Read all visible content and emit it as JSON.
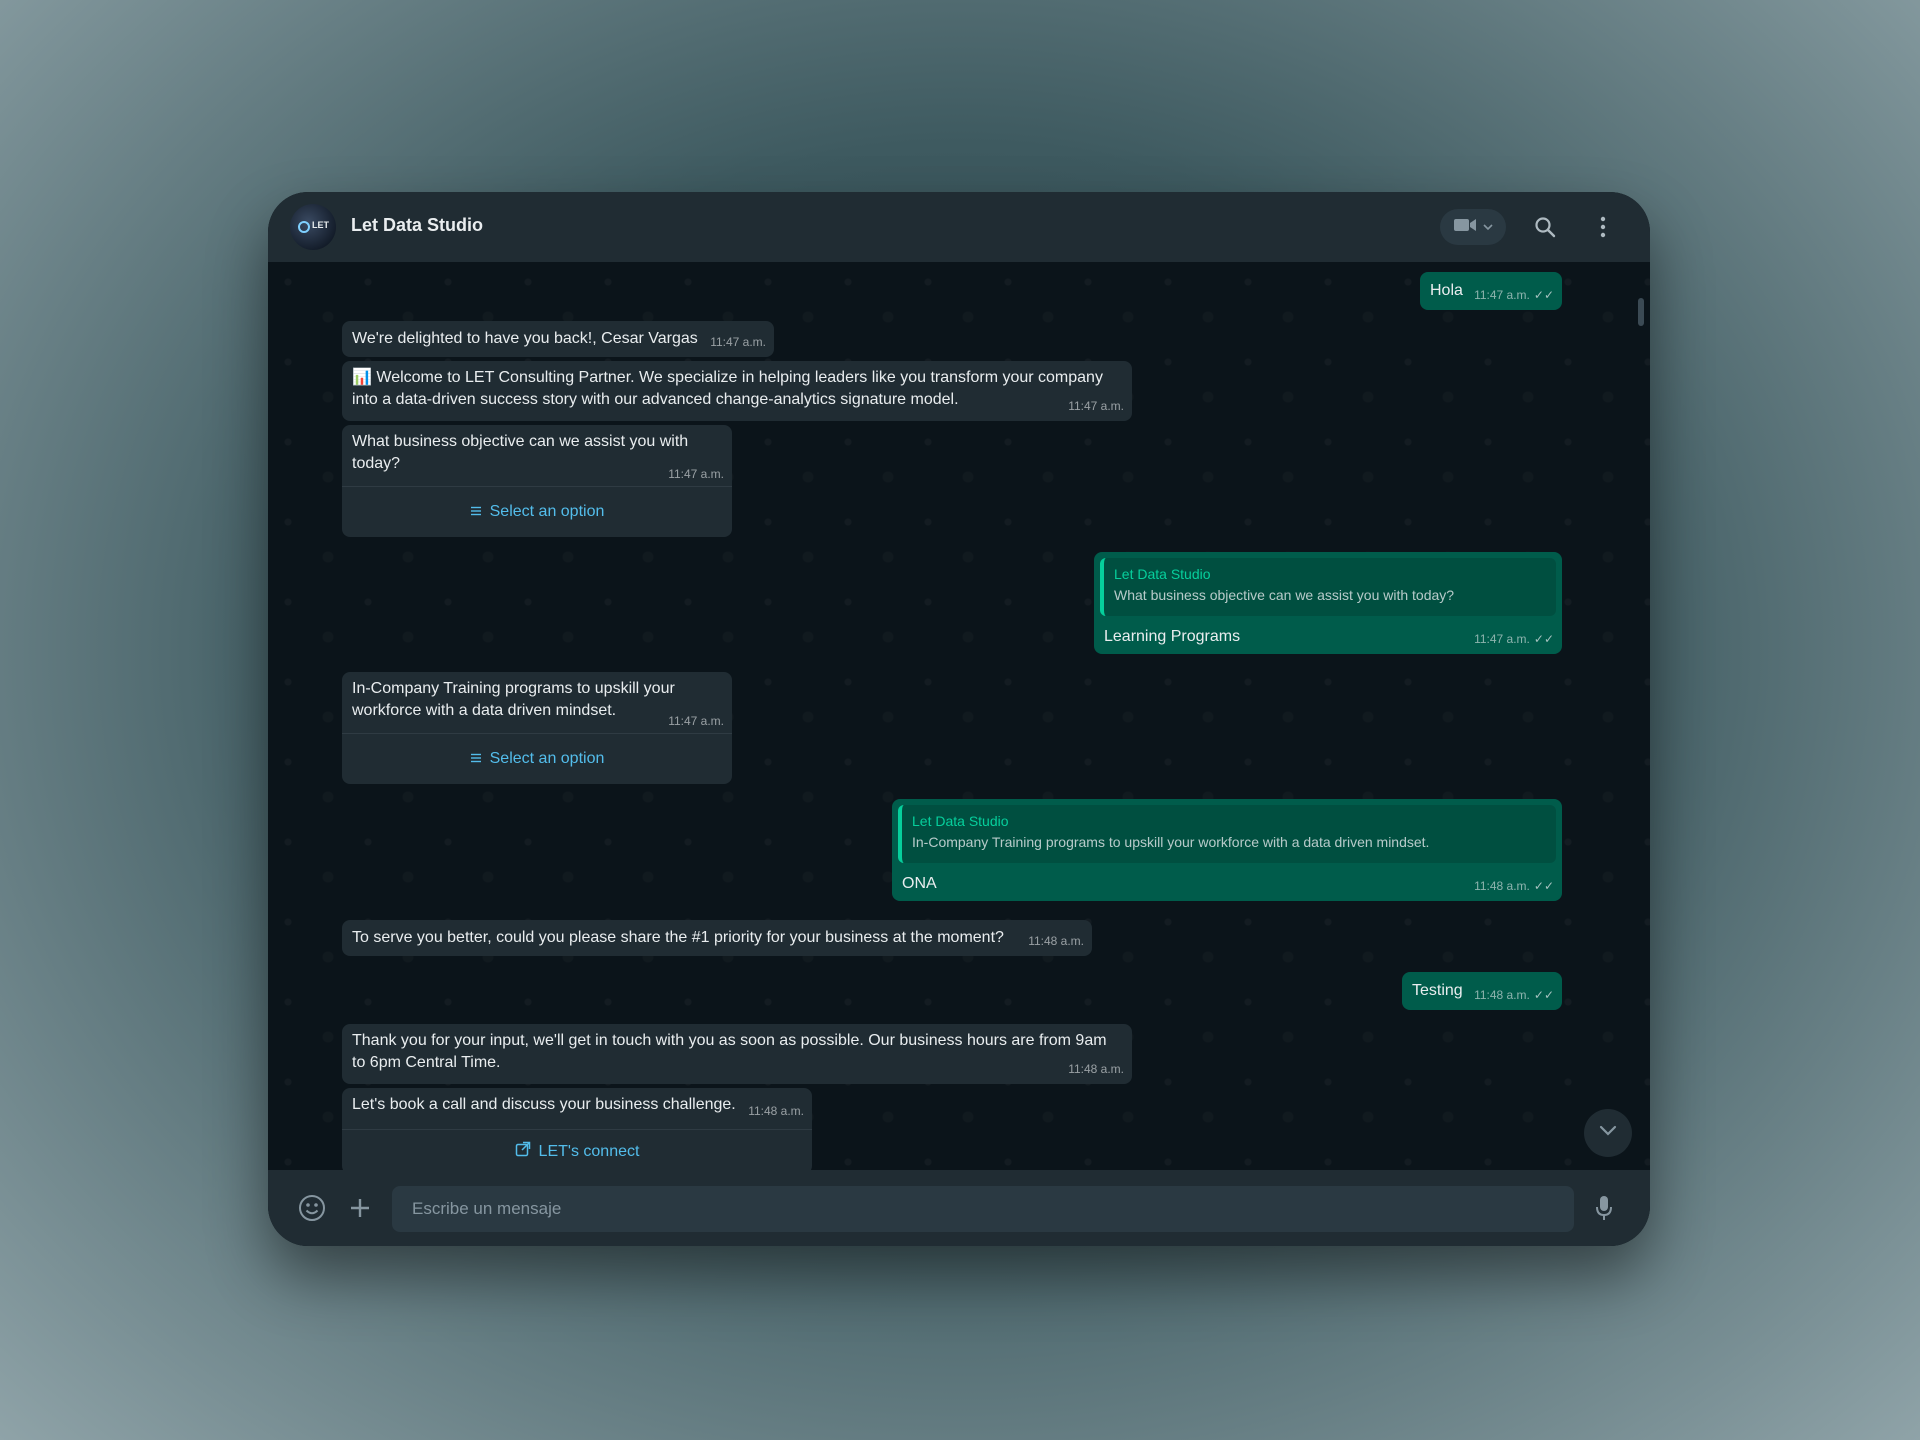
{
  "header": {
    "title": "Let Data Studio",
    "avatar_text": "LET",
    "video_icon": "video-camera-icon",
    "search_icon": "search-icon",
    "menu_icon": "kebab-menu-icon"
  },
  "messages": [
    {
      "id": "m1",
      "dir": "out",
      "text": "Hola",
      "time": "11:47 a.m."
    },
    {
      "id": "m2",
      "dir": "in",
      "text": "We're delighted to have you back!, Cesar Vargas",
      "time": "11:47 a.m."
    },
    {
      "id": "m3",
      "dir": "in",
      "emoji": "📊",
      "text": "Welcome to LET Consulting Partner. We specialize in helping leaders like you transform your company into a data-driven success story with our advanced change-analytics signature model.",
      "time": "11:47 a.m."
    },
    {
      "id": "m4",
      "dir": "in",
      "text": "What business objective can we assist you with today?",
      "time": "11:47 a.m.",
      "button": "Select an option"
    },
    {
      "id": "m5",
      "dir": "out",
      "quote_name": "Let Data Studio",
      "quote_text": "What business objective can we assist you with today?",
      "text": "Learning Programs",
      "time": "11:47 a.m."
    },
    {
      "id": "m6",
      "dir": "in",
      "text": "In-Company Training programs to upskill your workforce with a data driven mindset.",
      "time": "11:47 a.m.",
      "button": "Select an option"
    },
    {
      "id": "m7",
      "dir": "out",
      "quote_name": "Let Data Studio",
      "quote_text": "In-Company Training programs to upskill your workforce with a data driven mindset.",
      "text": "ONA",
      "time": "11:48 a.m."
    },
    {
      "id": "m8",
      "dir": "in",
      "text": "To serve you better, could you please share the #1 priority for your business at the moment?",
      "time": "11:48 a.m."
    },
    {
      "id": "m9",
      "dir": "out",
      "text": "Testing",
      "time": "11:48 a.m."
    },
    {
      "id": "m10",
      "dir": "in",
      "text": "Thank you for your input, we'll get in touch with you as soon as possible. Our business hours are from 9am to 6pm Central Time.",
      "time": "11:48 a.m."
    },
    {
      "id": "m11",
      "dir": "in",
      "text": "Let's book a call and discuss your business challenge.",
      "time": "11:48 a.m.",
      "button": "LET's connect"
    }
  ],
  "composer": {
    "placeholder": "Escribe un mensaje",
    "emoji_icon": "emoji-icon",
    "attach_icon": "plus-icon",
    "mic_icon": "microphone-icon"
  },
  "colors": {
    "incoming_bubble": "#202c33",
    "outgoing_bubble": "#005c4b",
    "link": "#53bdeb",
    "quote_accent": "#06cf9c"
  }
}
